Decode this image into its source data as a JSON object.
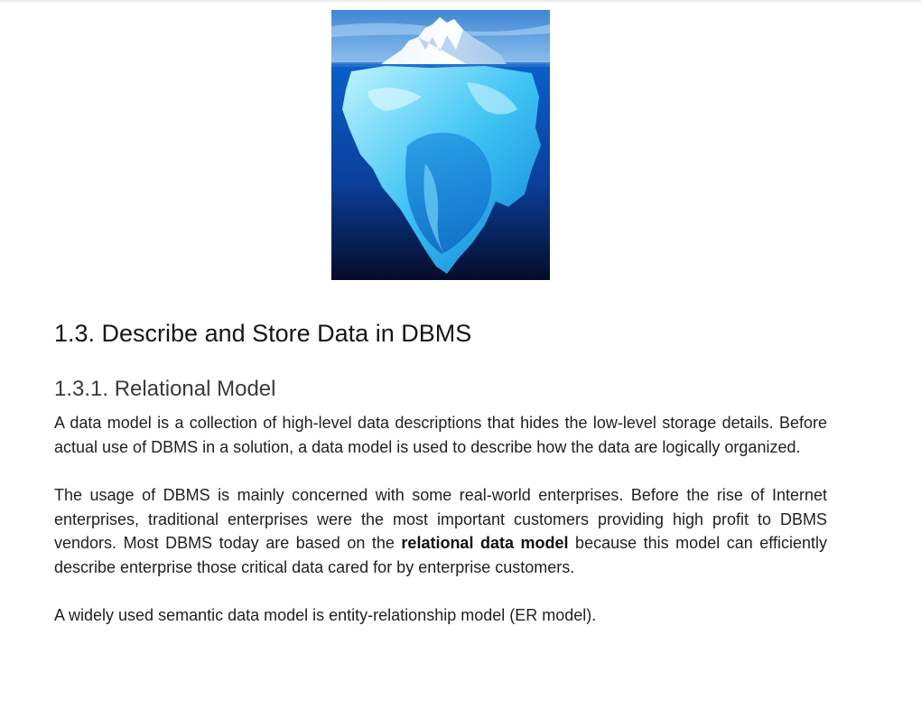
{
  "figure": {
    "description_icon": "iceberg-image"
  },
  "section": {
    "title": "1.3. Describe and Store Data in DBMS"
  },
  "subsection": {
    "title": "1.3.1. Relational Model"
  },
  "paragraphs": {
    "p1": "A data model is a collection of high-level data descriptions that hides the low-level storage details. Before actual use of DBMS in a solution, a data model is used to describe how the data are logically organized.",
    "p2_before": "The usage of DBMS is mainly concerned with some real-world enterprises. Before the rise of Internet enterprises, traditional enterprises were the most important customers providing high profit to DBMS vendors. Most DBMS today are based on the ",
    "p2_bold": "relational data model",
    "p2_after": " because this model can efficiently describe enterprise those critical data cared for by enterprise customers.",
    "p3": "A widely used semantic data model is entity-relationship model (ER model)."
  }
}
